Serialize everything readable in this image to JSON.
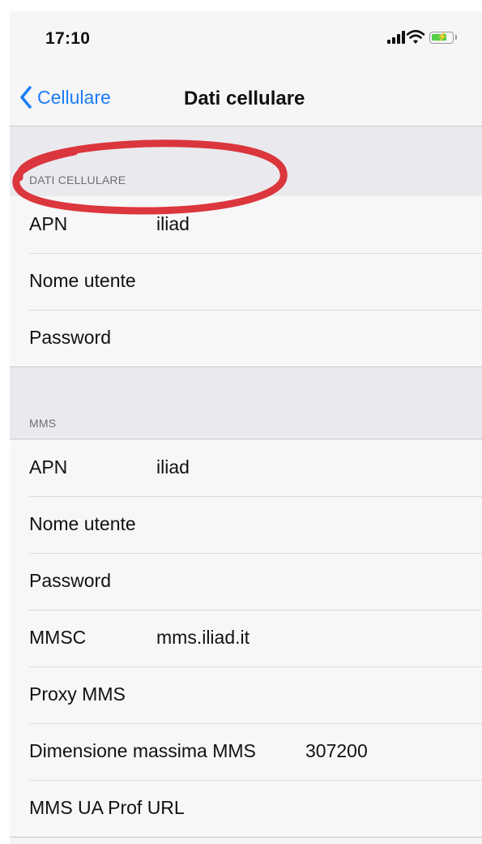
{
  "status_bar": {
    "time": "17:10",
    "icons": [
      "signal-icon",
      "wifi-icon",
      "battery-charging-icon"
    ]
  },
  "nav": {
    "back_label": "Cellulare",
    "title": "Dati cellulare"
  },
  "sections": [
    {
      "header": "DATI CELLULARE",
      "rows": [
        {
          "label": "APN",
          "value": "iliad"
        },
        {
          "label": "Nome utente",
          "value": ""
        },
        {
          "label": "Password",
          "value": ""
        }
      ]
    },
    {
      "header": "MMS",
      "rows": [
        {
          "label": "APN",
          "value": "iliad"
        },
        {
          "label": "Nome utente",
          "value": ""
        },
        {
          "label": "Password",
          "value": ""
        },
        {
          "label": "MMSC",
          "value": "mms.iliad.it"
        },
        {
          "label": "Proxy MMS",
          "value": ""
        },
        {
          "label": "Dimensione massima MMS",
          "value": "307200"
        },
        {
          "label": "MMS UA Prof URL",
          "value": ""
        }
      ]
    }
  ],
  "colors": {
    "accent": "#1a7cf5",
    "annotation": "#d9262e",
    "battery": "#53d14b"
  }
}
